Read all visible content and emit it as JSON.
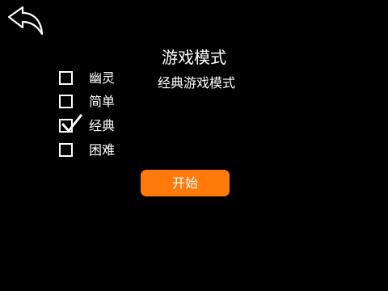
{
  "header": {
    "back_icon": "back-arrow-icon"
  },
  "mode_panel": {
    "title": "游戏模式",
    "description": "经典游戏模式"
  },
  "options": [
    {
      "label": "幽灵",
      "checked": false
    },
    {
      "label": "简单",
      "checked": false
    },
    {
      "label": "经典",
      "checked": true
    },
    {
      "label": "困难",
      "checked": false
    }
  ],
  "start_button": {
    "label": "开始"
  },
  "colors": {
    "background": "#000000",
    "text": "#ffffff",
    "accent": "#ff7a0a"
  }
}
